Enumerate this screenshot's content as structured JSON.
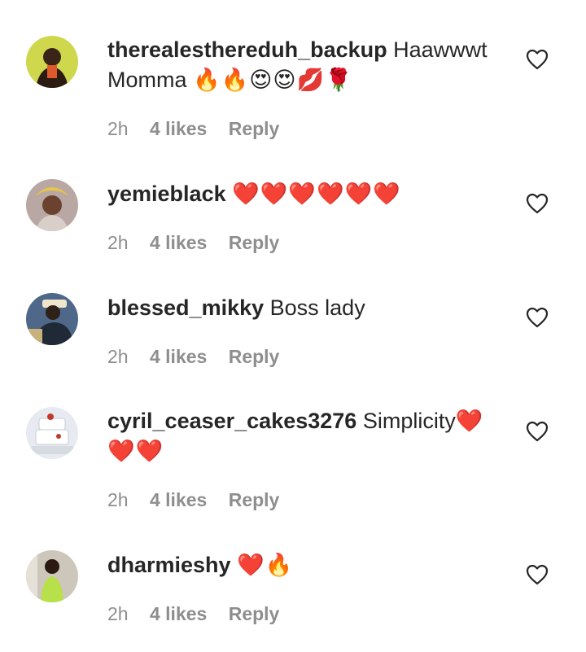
{
  "comments": [
    {
      "username": "therealesthereduh_backup",
      "text": "Haawwwt Momma",
      "emojis": "🔥🔥😍😍💋🌹",
      "time": "2h",
      "likes": "4 likes",
      "reply": "Reply",
      "avatar_colors": [
        "#c9d44a",
        "#2b1b12"
      ]
    },
    {
      "username": "yemieblack",
      "text": "",
      "emojis": "❤️❤️❤️❤️❤️❤️",
      "time": "2h",
      "likes": "4 likes",
      "reply": "Reply",
      "avatar_colors": [
        "#b9a7a3",
        "#e8c547"
      ]
    },
    {
      "username": "blessed_mikky",
      "text": "Boss lady",
      "emojis": "",
      "time": "2h",
      "likes": "4 likes",
      "reply": "Reply",
      "avatar_colors": [
        "#5a7090",
        "#2a3440"
      ]
    },
    {
      "username": "cyril_ceaser_cakes3276",
      "text": "Simplicity",
      "emojis": "❤️❤️❤️",
      "time": "2h",
      "likes": "4 likes",
      "reply": "Reply",
      "avatar_colors": [
        "#dfe3ea",
        "#c0392b"
      ]
    },
    {
      "username": "dharmieshy",
      "text": "",
      "emojis": "❤️🔥",
      "time": "2h",
      "likes": "4 likes",
      "reply": "Reply",
      "avatar_colors": [
        "#cfc7bc",
        "#b7e04a"
      ]
    }
  ],
  "icons": {
    "like": "heart-outline-icon"
  },
  "colors": {
    "text": "#262626",
    "meta": "#8e8e8e",
    "heart_stroke": "#262626"
  }
}
